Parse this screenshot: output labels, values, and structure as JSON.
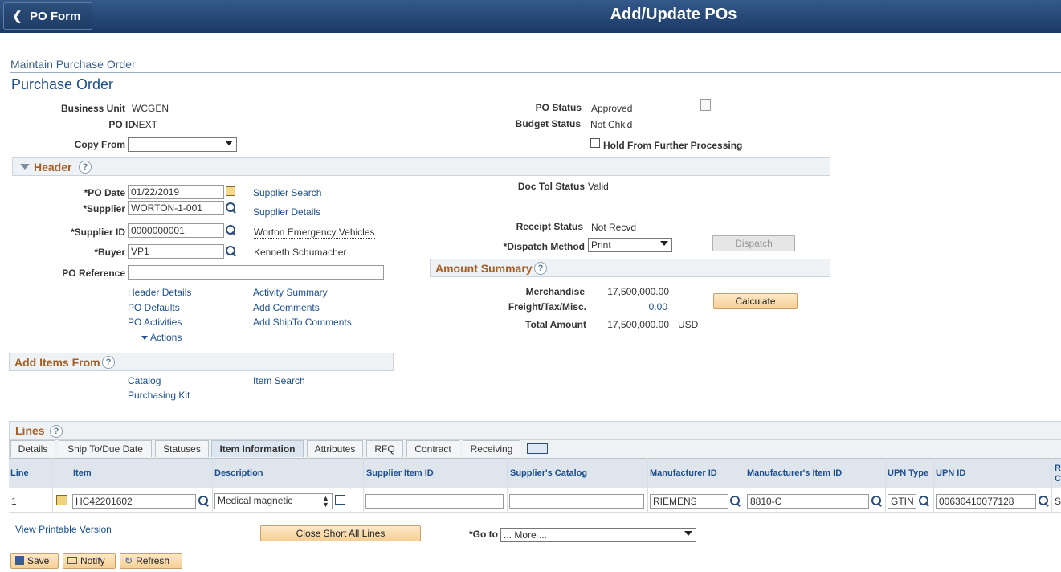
{
  "topbar": {
    "back_label": "PO Form",
    "title": "Add/Update POs"
  },
  "breadcrumb": "Maintain Purchase Order",
  "page_heading": "Purchase Order",
  "top_fields": {
    "business_unit_label": "Business Unit",
    "business_unit": "WCGEN",
    "po_id_label": "PO ID",
    "po_id": "NEXT",
    "copy_from_label": "Copy From",
    "copy_from": "",
    "po_status_label": "PO Status",
    "po_status": "Approved",
    "budget_status_label": "Budget Status",
    "budget_status": "Not Chk'd",
    "hold_label": "Hold From Further Processing"
  },
  "header_section": {
    "title": "Header",
    "po_date_label": "*PO Date",
    "po_date": "01/22/2019",
    "supplier_label": "*Supplier",
    "supplier": "WORTON-1-001",
    "supplier_id_label": "*Supplier ID",
    "supplier_id": "0000000001",
    "buyer_label": "*Buyer",
    "buyer": "VP1",
    "po_reference_label": "PO Reference",
    "po_reference": "",
    "supplier_search": "Supplier Search",
    "supplier_details": "Supplier Details",
    "supplier_name": "Worton Emergency Vehicles",
    "buyer_name": "Kenneth Schumacher",
    "doc_tol_label": "Doc Tol Status",
    "doc_tol": "Valid",
    "receipt_status_label": "Receipt Status",
    "receipt_status": "Not Recvd",
    "dispatch_method_label": "*Dispatch Method",
    "dispatch_method": "Print",
    "dispatch_button": "Dispatch",
    "links": [
      "Header Details",
      "PO Defaults",
      "PO Activities",
      "Activity Summary",
      "Add Comments",
      "Add ShipTo Comments"
    ],
    "actions": "Actions"
  },
  "amount_summary": {
    "title": "Amount Summary",
    "merchandise_label": "Merchandise",
    "merchandise": "17,500,000.00",
    "freight_label": "Freight/Tax/Misc.",
    "freight": "0.00",
    "total_label": "Total Amount",
    "total": "17,500,000.00",
    "currency": "USD",
    "calculate_button": "Calculate"
  },
  "add_items": {
    "title": "Add Items From",
    "catalog": "Catalog",
    "item_search": "Item Search",
    "purchasing_kit": "Purchasing Kit"
  },
  "lines": {
    "title": "Lines",
    "tabs": [
      "Details",
      "Ship To/Due Date",
      "Statuses",
      "Item Information",
      "Attributes",
      "RFQ",
      "Contract",
      "Receiving"
    ],
    "active_tab": "Item Information",
    "columns": [
      "Line",
      "Item",
      "Description",
      "Supplier Item ID",
      "Supplier's Catalog",
      "Manufacturer ID",
      "Manufacturer's Item ID",
      "UPN Type",
      "UPN ID",
      "R",
      "C"
    ],
    "row": {
      "line": "1",
      "item": "HC42201602",
      "description": "Medical magnetic",
      "supplier_item_id": "",
      "supplier_catalog": "",
      "manufacturer_id": "RIEMENS",
      "manufacturer_item_id": "8810-C",
      "upn_type": "GTIN",
      "upn_id": "00630410077128",
      "trailing": "S"
    }
  },
  "footer": {
    "printable": "View Printable Version",
    "close_short": "Close Short All Lines",
    "goto_label": "*Go to",
    "goto_value": "... More ...",
    "save": "Save",
    "notify": "Notify",
    "refresh": "Refresh"
  },
  "colors": {
    "topbar": "#1b3a66",
    "section_title": "#a55f25",
    "link": "#1b4f8f",
    "button_orange": "#f6cf93"
  }
}
